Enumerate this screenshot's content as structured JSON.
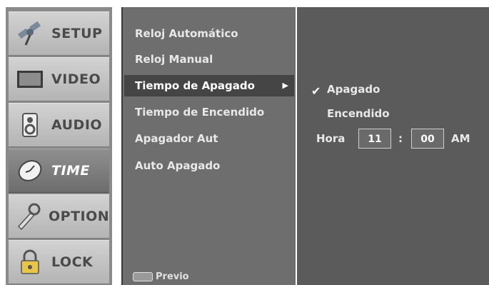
{
  "tabs": [
    {
      "id": "setup",
      "label": "SETUP",
      "icon": "satellite-icon",
      "active": false
    },
    {
      "id": "video",
      "label": "VIDEO",
      "icon": "monitor-icon",
      "active": false
    },
    {
      "id": "audio",
      "label": "AUDIO",
      "icon": "speaker-icon",
      "active": false
    },
    {
      "id": "time",
      "label": "TIME",
      "icon": "clock-icon",
      "active": true
    },
    {
      "id": "option",
      "label": "OPTION",
      "icon": "wrench-icon",
      "active": false
    },
    {
      "id": "lock",
      "label": "LOCK",
      "icon": "padlock-icon",
      "active": false
    }
  ],
  "menu": {
    "items": [
      "Reloj Automático",
      "Reloj Manual",
      "Tiempo de Apagado",
      "Tiempo de Encendido",
      "Apagador Aut",
      "Auto Apagado"
    ],
    "selected_index": 2,
    "footer_label": "Previo"
  },
  "options": {
    "off_label": "Apagado",
    "on_label": "Encendido",
    "checked": "Apagado",
    "hour_label": "Hora",
    "hour_value": "11",
    "separator": ":",
    "minute_value": "00",
    "ampm": "AM"
  }
}
